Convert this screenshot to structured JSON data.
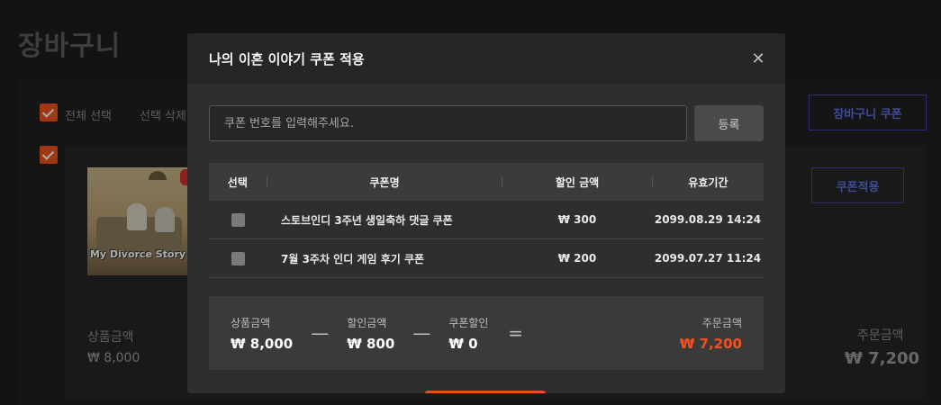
{
  "background": {
    "page_title": "장바구니",
    "select_all_label": "전체 선택",
    "delete_selected_label": "선택 삭제",
    "cart_coupon_button": "장바구니 쿠폰",
    "apply_coupon_button": "쿠폰적용",
    "thumbnail_title": "My Divorce Story",
    "product_amount_label": "상품금액",
    "product_amount_value": "₩ 8,000",
    "order_amount_label": "주문금액",
    "order_amount_value": "₩ 7,200"
  },
  "modal": {
    "title": "나의 이혼 이야기 쿠폰 적용",
    "close_icon": "close-icon",
    "coupon_input_placeholder": "쿠폰 번호를 입력해주세요.",
    "register_button": "등록",
    "table": {
      "headers": [
        "선택",
        "쿠폰명",
        "할인 금액",
        "유효기간"
      ],
      "rows": [
        {
          "name": "스토브인디 3주년 생일축하 댓글 쿠폰",
          "discount": "₩ 300",
          "expiry": "2099.08.29 14:24"
        },
        {
          "name": "7월 3주차 인디 게임 후기 쿠폰",
          "discount": "₩ 200",
          "expiry": "2099.07.27 11:24"
        }
      ]
    },
    "summary": {
      "product_label": "상품금액",
      "product_value": "₩ 8,000",
      "minus1": "—",
      "discount_label": "할인금액",
      "discount_value": "₩ 800",
      "minus2": "—",
      "coupon_label": "쿠폰할인",
      "coupon_value": "₩ 0",
      "equals": "=",
      "total_label": "주문금액",
      "total_value": "₩ 7,200"
    }
  },
  "colors": {
    "accent_orange": "#f0531f",
    "accent_blue": "#5b6fe0",
    "modal_bg": "#2e2e2e"
  }
}
